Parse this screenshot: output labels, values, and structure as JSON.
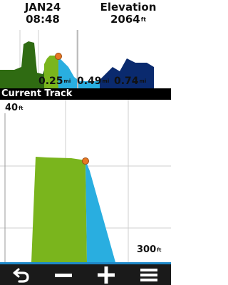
{
  "header": {
    "date": "JAN24",
    "time": "08:48",
    "elevation_title": "Elevation",
    "elevation_value": "2064",
    "elevation_unit": "ft"
  },
  "overview": {
    "distance_labels": [
      {
        "value": "0.25",
        "unit": "mi"
      },
      {
        "value": "0.49",
        "unit": "mi"
      },
      {
        "value": "0.74",
        "unit": "mi"
      }
    ]
  },
  "track": {
    "title": "Current Track",
    "y_top_label": "40",
    "y_top_unit": "ft",
    "x_right_label": "300",
    "x_right_unit": "ft"
  },
  "toolbar": {
    "buttons": [
      {
        "name": "back-button",
        "icon": "back-arrow-icon"
      },
      {
        "name": "zoom-out-button",
        "icon": "minus-icon"
      },
      {
        "name": "zoom-in-button",
        "icon": "plus-icon"
      },
      {
        "name": "menu-button",
        "icon": "menu-icon"
      }
    ]
  },
  "colors": {
    "profile_green": "#7ab51d",
    "profile_dark_green": "#2f6b12",
    "profile_blue": "#29aee0",
    "profile_navy": "#0a2a6e",
    "position_marker": "#e87722",
    "accent": "#1e88c8"
  }
}
